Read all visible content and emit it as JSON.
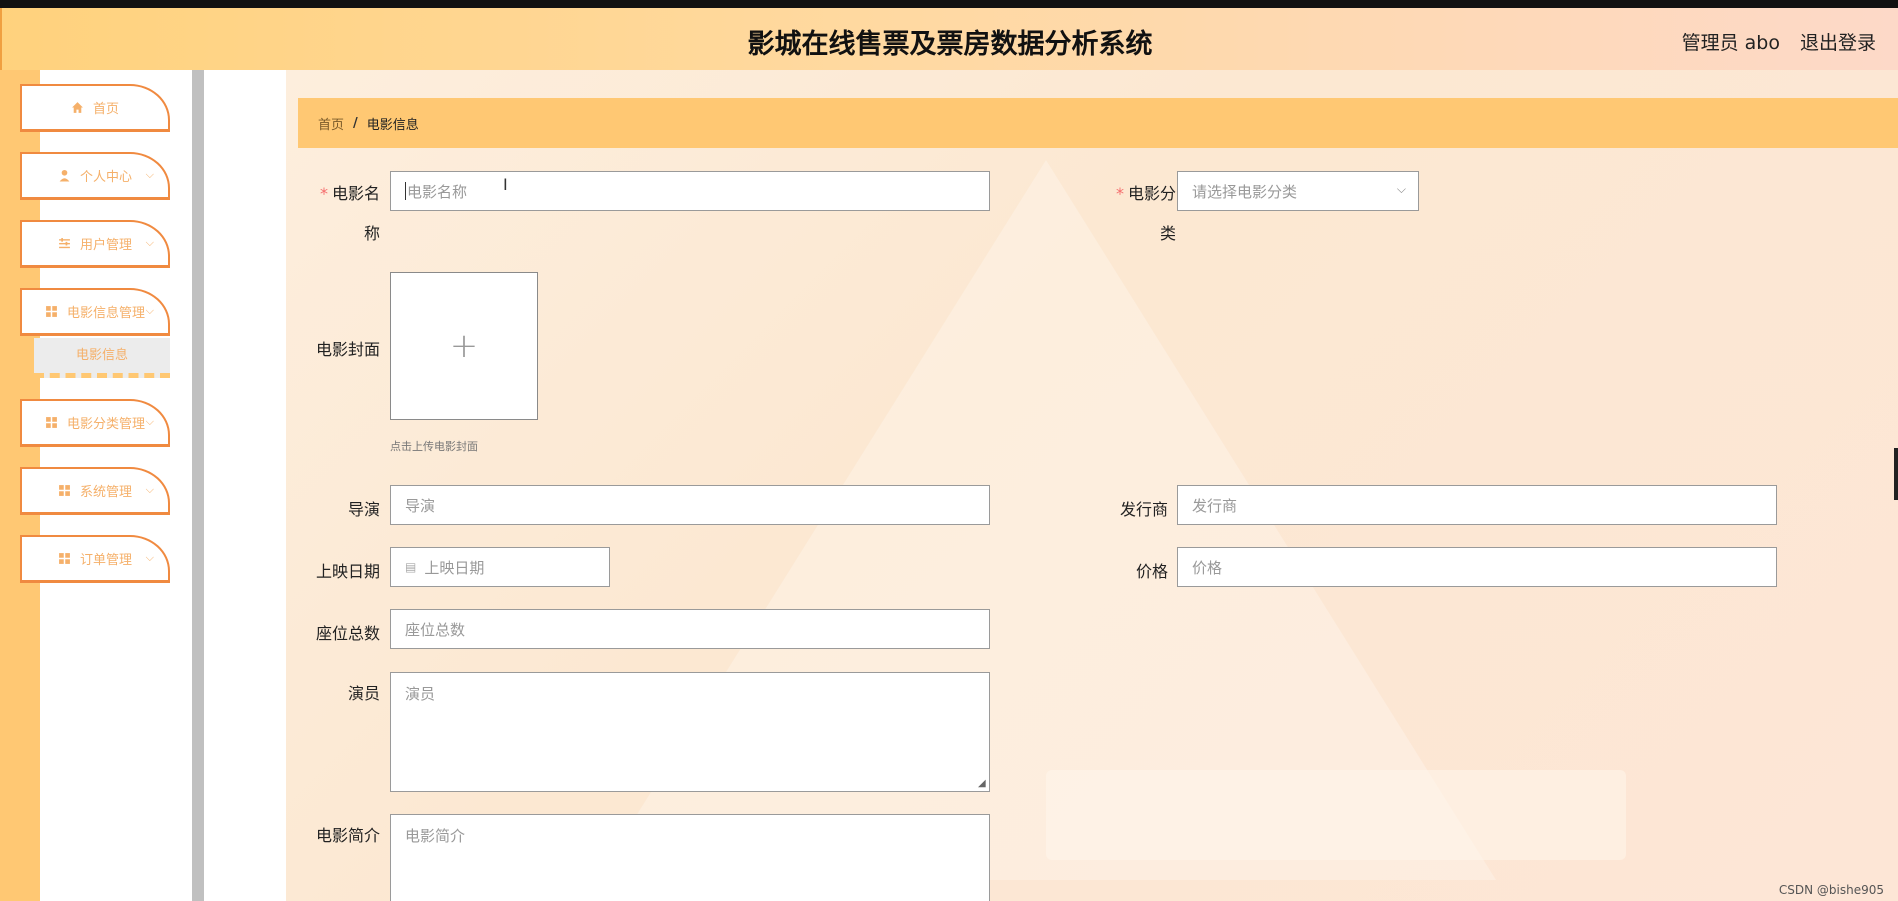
{
  "header": {
    "title": "影城在线售票及票房数据分析系统",
    "user": "管理员 abo",
    "logout": "退出登录"
  },
  "sidebar": {
    "items": [
      {
        "label": "首页",
        "icon": "home-icon"
      },
      {
        "label": "个人中心",
        "icon": "person-icon"
      },
      {
        "label": "用户管理",
        "icon": "sliders-icon"
      },
      {
        "label": "电影信息管理",
        "icon": "grid-icon"
      },
      {
        "label": "电影分类管理",
        "icon": "grid-icon"
      },
      {
        "label": "系统管理",
        "icon": "grid-icon"
      },
      {
        "label": "订单管理",
        "icon": "grid-icon"
      }
    ],
    "submenu": "电影信息"
  },
  "breadcrumb": {
    "home": "首页",
    "separator": "/",
    "current": "电影信息"
  },
  "form": {
    "name_label_1": "电影名",
    "name_label_2": "称",
    "name_placeholder": "电影名称",
    "category_label_1": "电影分",
    "category_label_2": "类",
    "category_placeholder": "请选择电影分类",
    "cover_label": "电影封面",
    "cover_plus": "+",
    "cover_hint": "点击上传电影封面",
    "director_label": "导演",
    "director_placeholder": "导演",
    "publisher_label": "发行商",
    "publisher_placeholder": "发行商",
    "date_label": "上映日期",
    "date_placeholder": "上映日期",
    "price_label": "价格",
    "price_placeholder": "价格",
    "seats_label": "座位总数",
    "seats_placeholder": "座位总数",
    "actors_label": "演员",
    "actors_placeholder": "演员",
    "intro_label": "电影简介",
    "intro_placeholder": "电影简介"
  },
  "watermark": "CSDN @bishe905",
  "colors": {
    "accent": "#ffc873",
    "menu_border": "#f08a40",
    "menu_text": "#f5b06a",
    "required": "#f56c6c"
  }
}
